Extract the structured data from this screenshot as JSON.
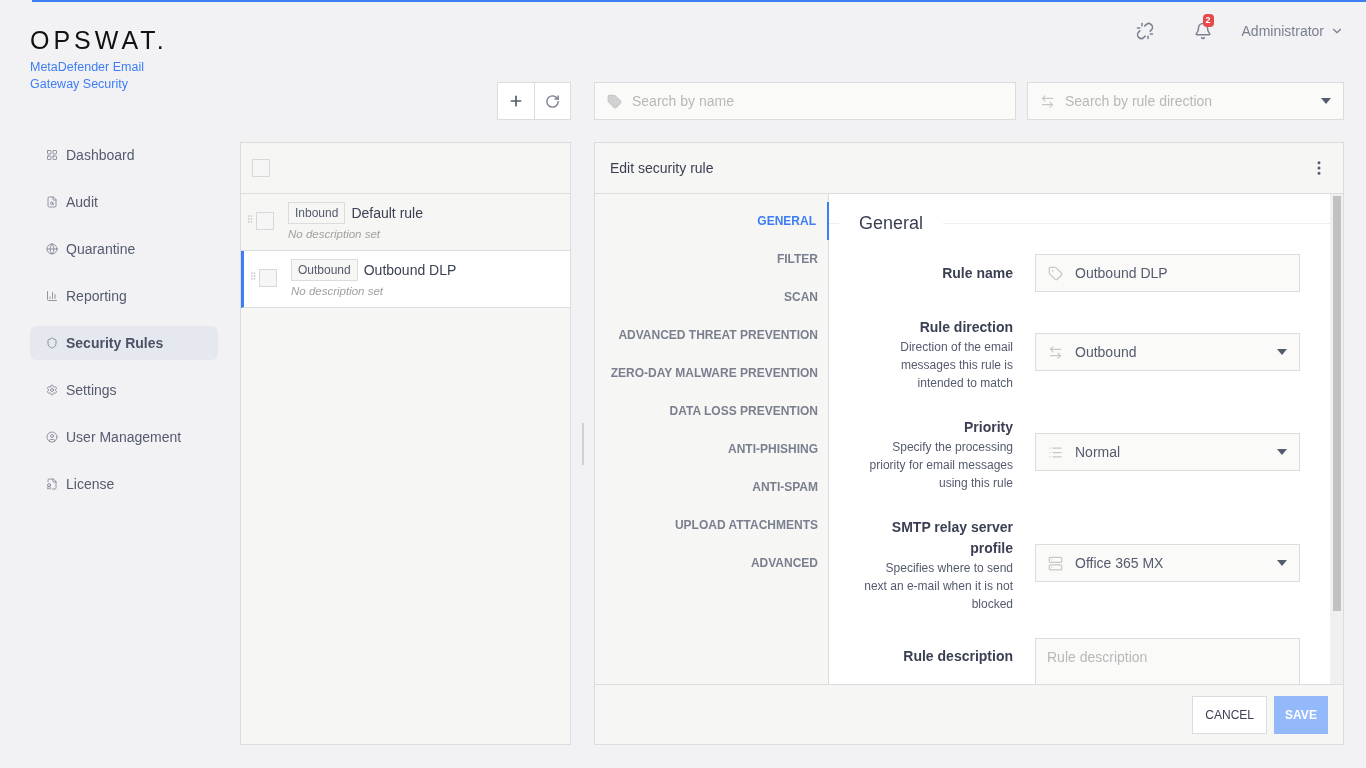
{
  "brand": {
    "logo": "OPSWAT.",
    "product": "MetaDefender Email Gateway Security"
  },
  "header": {
    "notifications": "2",
    "user": "Administrator"
  },
  "sidebar": {
    "items": [
      {
        "label": "Dashboard",
        "selected": false
      },
      {
        "label": "Audit",
        "selected": false
      },
      {
        "label": "Quarantine",
        "selected": false
      },
      {
        "label": "Reporting",
        "selected": false
      },
      {
        "label": "Security Rules",
        "selected": true
      },
      {
        "label": "Settings",
        "selected": false
      },
      {
        "label": "User Management",
        "selected": false
      },
      {
        "label": "License",
        "selected": false
      }
    ]
  },
  "toolbar": {
    "search": {
      "placeholder": "Search by name"
    },
    "direction": {
      "placeholder": "Search by rule direction"
    }
  },
  "rules": {
    "select_all": {
      "checked": false
    },
    "rows": [
      {
        "direction": "Inbound",
        "name": "Default rule",
        "description": "No description set",
        "checked": false,
        "selected": false
      },
      {
        "direction": "Outbound",
        "name": "Outbound DLP",
        "description": "No description set",
        "checked": false,
        "selected": true
      }
    ]
  },
  "editor": {
    "title": "Edit security rule",
    "tabs": [
      {
        "label": "GENERAL",
        "selected": true
      },
      {
        "label": "FILTER",
        "selected": false
      },
      {
        "label": "SCAN",
        "selected": false
      },
      {
        "label": "ADVANCED THREAT PREVENTION",
        "selected": false
      },
      {
        "label": "ZERO-DAY MALWARE PREVENTION",
        "selected": false
      },
      {
        "label": "DATA LOSS PREVENTION",
        "selected": false
      },
      {
        "label": "ANTI-PHISHING",
        "selected": false
      },
      {
        "label": "ANTI-SPAM",
        "selected": false
      },
      {
        "label": "UPLOAD ATTACHMENTS",
        "selected": false
      },
      {
        "label": "ADVANCED",
        "selected": false
      }
    ],
    "section": "General",
    "fields": [
      {
        "kind": "text",
        "label": "Rule name",
        "value": "Outbound DLP"
      },
      {
        "kind": "select",
        "label": "Rule direction",
        "help": "Direction of the email messages this rule is intended to match",
        "value": "Outbound"
      },
      {
        "kind": "select",
        "label": "Priority",
        "help": "Specify the processing priority for email messages using this rule",
        "value": "Normal"
      },
      {
        "kind": "select",
        "label": "SMTP relay server profile",
        "help": "Specifies where to send next an e-mail when it is not blocked",
        "value": "Office 365 MX"
      },
      {
        "kind": "textarea",
        "label": "Rule description",
        "placeholder": "Rule description"
      }
    ],
    "buttons": {
      "cancel": "CANCEL",
      "save": {
        "label": "SAVE",
        "disabled": true
      }
    }
  }
}
